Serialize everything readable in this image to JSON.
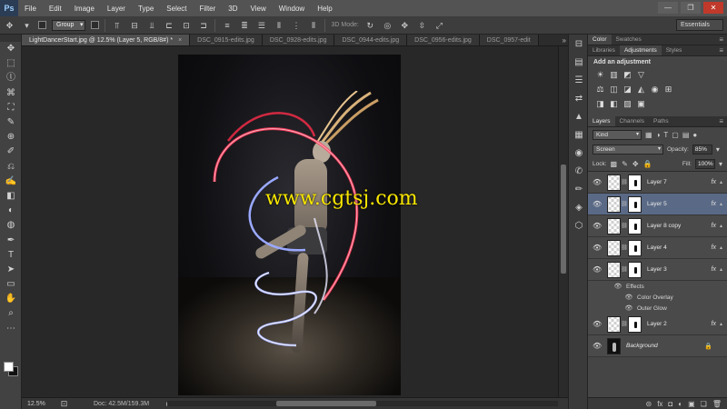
{
  "app": {
    "logo": "Ps"
  },
  "menu": [
    "File",
    "Edit",
    "Image",
    "Layer",
    "Type",
    "Select",
    "Filter",
    "3D",
    "View",
    "Window",
    "Help"
  ],
  "window_buttons": {
    "minimize": "—",
    "restore": "❐",
    "close": "✕"
  },
  "options_bar": {
    "auto_select_value": "Group",
    "mode_label": "3D Mode:",
    "workspace": "Essentials"
  },
  "tabs": [
    {
      "label": "LightDancerStart.jpg @ 12.5% (Layer 5, RGB/8#) *",
      "active": true
    },
    {
      "label": "DSC_0915-edits.jpg",
      "active": false
    },
    {
      "label": "DSC_0928-edits.jpg",
      "active": false
    },
    {
      "label": "DSC_0944-edits.jpg",
      "active": false
    },
    {
      "label": "DSC_0956-edits.jpg",
      "active": false
    },
    {
      "label": "DSC_0957-edit",
      "active": false
    }
  ],
  "tab_close": "×",
  "tab_overflow": "»",
  "watermark": "www.cgtsj.com",
  "status": {
    "zoom": "12.5%",
    "doc": "Doc: 42.5M/159.3M",
    "arrow": "▸"
  },
  "tools": [
    "✥",
    "⬚",
    "ⓛ",
    "⌘",
    "⛶",
    "✎",
    "⊕",
    "✐",
    "⎌",
    "✍",
    "◧",
    "◐",
    "◍",
    "✒",
    "T",
    "➤",
    "▭",
    "✋",
    "⌕",
    "⋯"
  ],
  "icon_strip": [
    "⊟",
    "▤",
    "☰",
    "⇄",
    "▲",
    "▦",
    "◉",
    "✆",
    "✏",
    "◈",
    "⬡"
  ],
  "panels": {
    "color_tabs": [
      "Color",
      "Swatches"
    ],
    "adjust_tabs": [
      "Libraries",
      "Adjustments",
      "Styles"
    ],
    "adjust_title": "Add an adjustment",
    "adjust_row1": [
      "☀",
      "▥",
      "◩",
      "▽"
    ],
    "adjust_row2": [
      "⚖",
      "◫",
      "◪",
      "◭",
      "◉",
      "⊞"
    ],
    "adjust_row3": [
      "◨",
      "◧",
      "▨",
      "▣"
    ],
    "layers_tabs": [
      "Layers",
      "Channels",
      "Paths"
    ],
    "kind_filter": "Kind",
    "filter_icons": [
      "▦",
      "◑",
      "T",
      "▢",
      "▤",
      "●"
    ],
    "blend_mode": "Screen",
    "opacity_label": "Opacity:",
    "opacity_value": "85%",
    "lock_label": "Lock:",
    "lock_icons": [
      "▩",
      "✎",
      "✥",
      "🔒"
    ],
    "fill_label": "Fill:",
    "fill_value": "100%",
    "menu_icon": "≡"
  },
  "layers": [
    {
      "name": "Layer 7",
      "selected": false,
      "fx": "fx"
    },
    {
      "name": "Layer 5",
      "selected": true,
      "fx": "fx"
    },
    {
      "name": "Layer 8 copy",
      "selected": false,
      "fx": "fx"
    },
    {
      "name": "Layer 4",
      "selected": false,
      "fx": "fx"
    },
    {
      "name": "Layer 3",
      "selected": false,
      "fx": "fx"
    }
  ],
  "layer3_effects": {
    "title": "Effects",
    "items": [
      "Color Overlay",
      "Outer Glow"
    ]
  },
  "layer_after": {
    "name": "Layer 2",
    "fx": "fx"
  },
  "background_layer": {
    "name": "Background",
    "lock": "🔒"
  },
  "layers_footer": [
    "⊝",
    "fx",
    "◘",
    "◐",
    "▣",
    "❏",
    "🗑"
  ],
  "colors": {
    "accent_selected": "#5a6a86",
    "watermark": "#f7e600"
  }
}
